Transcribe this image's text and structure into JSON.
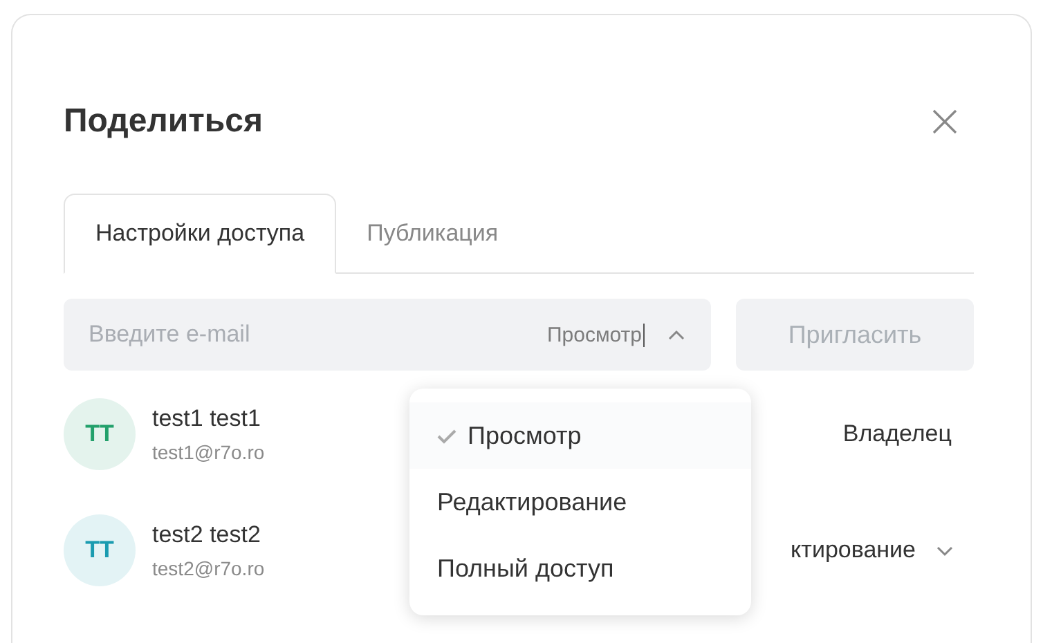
{
  "dialog": {
    "title": "Поделиться"
  },
  "tabs": [
    {
      "label": "Настройки доступа",
      "selected": true
    },
    {
      "label": "Публикация",
      "selected": false
    }
  ],
  "invite": {
    "placeholder": "Введите e-mail",
    "access": "Просмотр",
    "expanded": true,
    "button": "Пригласить",
    "disabled": true
  },
  "users": [
    {
      "initials": "TT",
      "color": "#22a06b",
      "name": "test1 test1",
      "email": "test1@r7o.ro",
      "role": "Владелец",
      "kind": "fixed"
    },
    {
      "initials": "TT",
      "color": "#1a9bb0",
      "name": "test2 test2",
      "email": "test2@r7o.ro",
      "role": "ктирование",
      "kind": "select"
    }
  ],
  "menu": [
    {
      "label": "Просмотр",
      "selected": true
    },
    {
      "label": "Редактирование",
      "selected": false
    },
    {
      "label": "Полный доступ",
      "selected": false
    }
  ]
}
